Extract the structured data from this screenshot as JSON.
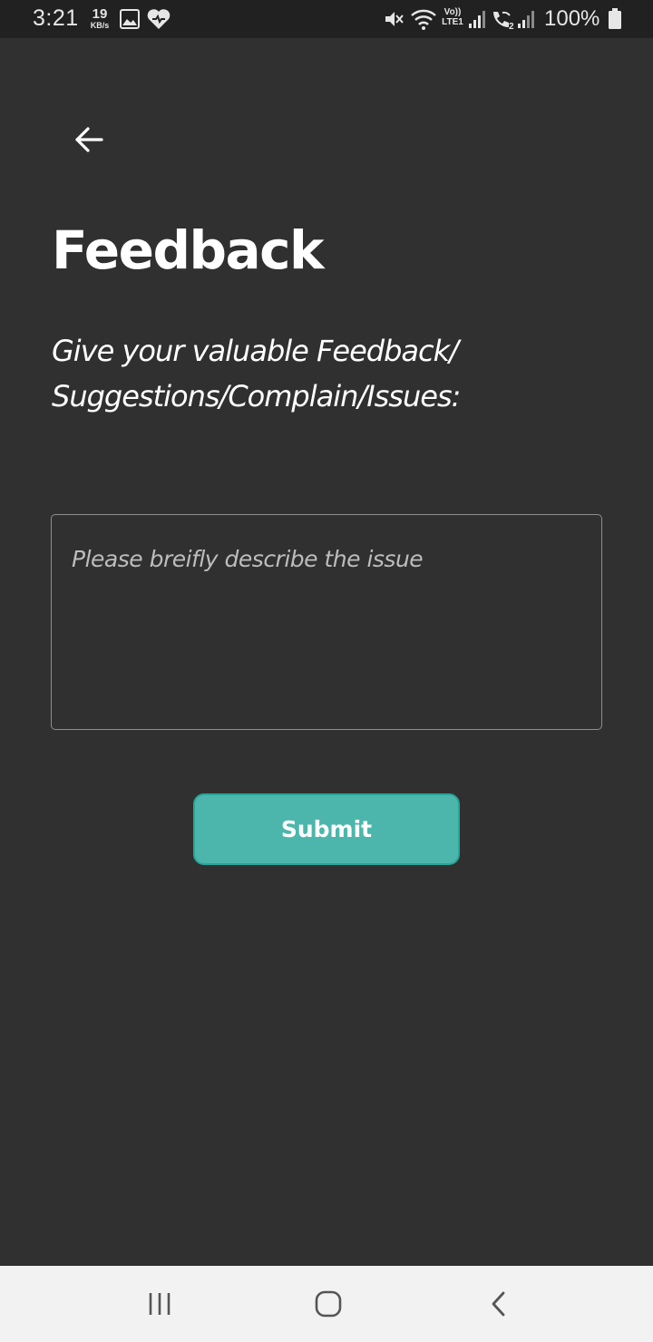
{
  "status_bar": {
    "time": "3:21",
    "net_speed_value": "19",
    "net_speed_unit": "KB/s",
    "net_label_top": "Vo))",
    "net_label_bottom": "LTE1",
    "battery": "100%",
    "icons": [
      "image-icon",
      "health-heart-icon",
      "vibrate-mute-icon",
      "wifi-icon",
      "signal-icon",
      "wifi-calling-icon",
      "signal-icon",
      "battery-icon"
    ]
  },
  "header": {
    "back_icon": "arrow-left-icon"
  },
  "main": {
    "title": "Feedback",
    "subtitle": "Give your valuable Feedback/ Suggestions/Complain/Issues:",
    "feedback_input": {
      "value": "",
      "placeholder": "Please breifly describe the issue"
    },
    "submit_label": "Submit"
  },
  "nav_bar": {
    "icons": [
      "recent-apps-icon",
      "home-icon",
      "back-icon"
    ]
  },
  "colors": {
    "background": "#303030",
    "status_bar": "#212121",
    "accent": "#4db6ac",
    "nav_bar": "#f2f2f2"
  }
}
